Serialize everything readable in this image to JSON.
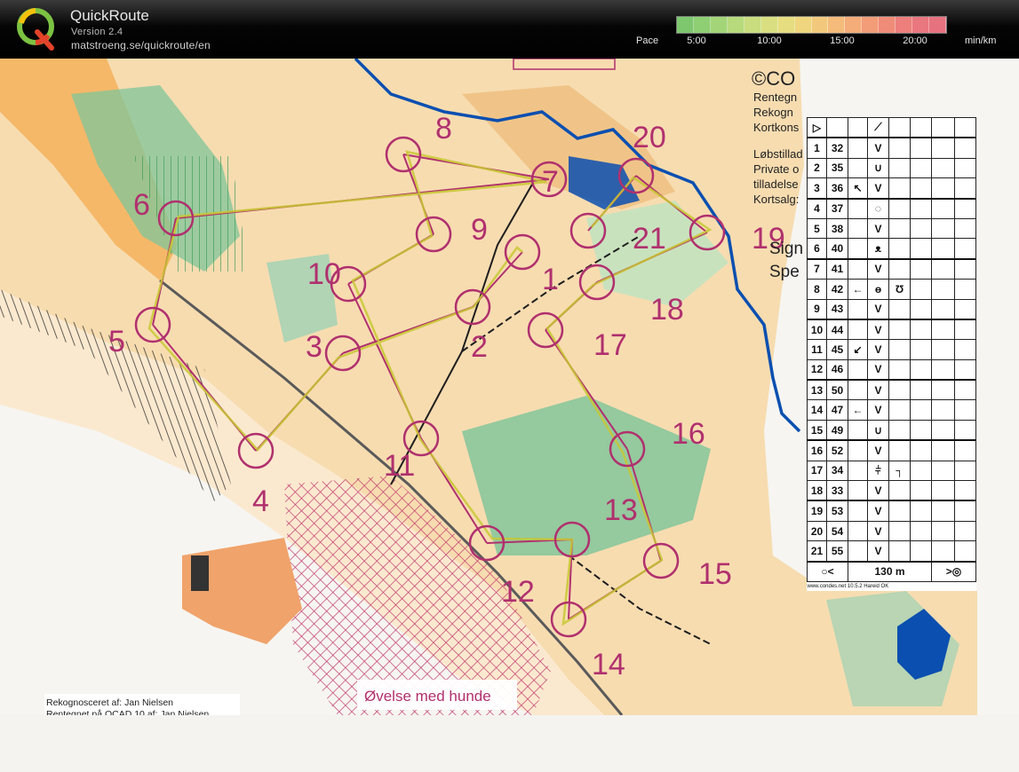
{
  "app": {
    "title": "QuickRoute",
    "version": "Version 2.4",
    "url": "matstroeng.se/quickroute/en",
    "logo_letter": "Q"
  },
  "pace_scale": {
    "label": "Pace",
    "ticks": [
      "5:00",
      "10:00",
      "15:00",
      "20:00"
    ],
    "unit": "min/km",
    "colors": [
      "#7ec76f",
      "#8fcf73",
      "#a3d578",
      "#b7da7c",
      "#c9dd7f",
      "#d9df80",
      "#e6dc80",
      "#eed57e",
      "#f2c97c",
      "#f4bb7a",
      "#f4ac78",
      "#f29c78",
      "#ef8c79",
      "#ec7f7c",
      "#e9777f",
      "#e7727f"
    ]
  },
  "map": {
    "background": "#f6e2c4",
    "course_color": "#b0306e",
    "route_color": "#c8c832",
    "water_color": "#0b4fb0",
    "copyright_text": "©CO",
    "info_lines": [
      "Rentegn",
      "Rekogn",
      "Kortkons",
      "Løbstillad",
      "Private o",
      "tilladelse",
      "Kortsalg:"
    ],
    "sign_lines": [
      "Sign",
      "Spe"
    ],
    "footer_lines": [
      "Rekognosceret af: Jan Nielsen",
      "Rentegnet på OCAD 10 af: Jan Nielsen"
    ],
    "exercise_label": "Øvelse med hunde",
    "controls": [
      {
        "num": "1",
        "label_num": "1"
      },
      {
        "num": "2",
        "label_num": "2"
      },
      {
        "num": "3",
        "label_num": "3"
      },
      {
        "num": "4",
        "label_num": "4"
      },
      {
        "num": "5",
        "label_num": "5"
      },
      {
        "num": "6",
        "label_num": "6"
      },
      {
        "num": "7",
        "label_num": "7"
      },
      {
        "num": "8",
        "label_num": "8"
      },
      {
        "num": "9",
        "label_num": "9"
      },
      {
        "num": "10",
        "label_num": "10"
      },
      {
        "num": "11",
        "label_num": "11"
      },
      {
        "num": "12",
        "label_num": "12"
      },
      {
        "num": "13",
        "label_num": "13"
      },
      {
        "num": "14",
        "label_num": "14"
      },
      {
        "num": "15",
        "label_num": "15"
      },
      {
        "num": "16",
        "label_num": "16"
      },
      {
        "num": "17",
        "label_num": "17"
      },
      {
        "num": "18",
        "label_num": "18"
      },
      {
        "num": "19",
        "label_num": "19"
      },
      {
        "num": "20",
        "label_num": "20"
      },
      {
        "num": "21",
        "label_num": "21"
      }
    ]
  },
  "description_sheet": {
    "rows": [
      {
        "n": "1",
        "code": "32",
        "dir": "",
        "feature": "V",
        "appearance": ""
      },
      {
        "n": "2",
        "code": "35",
        "dir": "",
        "feature": "∪",
        "appearance": ""
      },
      {
        "n": "3",
        "code": "36",
        "dir": "↖",
        "feature": "V",
        "appearance": ""
      },
      {
        "n": "4",
        "code": "37",
        "dir": "",
        "feature": "◌",
        "appearance": ""
      },
      {
        "n": "5",
        "code": "38",
        "dir": "",
        "feature": "V",
        "appearance": ""
      },
      {
        "n": "6",
        "code": "40",
        "dir": "",
        "feature": "ᴥ",
        "appearance": ""
      },
      {
        "n": "7",
        "code": "41",
        "dir": "",
        "feature": "V",
        "appearance": ""
      },
      {
        "n": "8",
        "code": "42",
        "dir": "←",
        "feature": "ɵ",
        "appearance": "Ʊ"
      },
      {
        "n": "9",
        "code": "43",
        "dir": "",
        "feature": "V",
        "appearance": ""
      },
      {
        "n": "10",
        "code": "44",
        "dir": "",
        "feature": "V",
        "appearance": ""
      },
      {
        "n": "11",
        "code": "45",
        "dir": "↙",
        "feature": "V",
        "appearance": ""
      },
      {
        "n": "12",
        "code": "46",
        "dir": "",
        "feature": "V",
        "appearance": ""
      },
      {
        "n": "13",
        "code": "50",
        "dir": "",
        "feature": "V",
        "appearance": ""
      },
      {
        "n": "14",
        "code": "47",
        "dir": "←",
        "feature": "V",
        "appearance": ""
      },
      {
        "n": "15",
        "code": "49",
        "dir": "",
        "feature": "∪",
        "appearance": ""
      },
      {
        "n": "16",
        "code": "52",
        "dir": "",
        "feature": "V",
        "appearance": ""
      },
      {
        "n": "17",
        "code": "34",
        "dir": "",
        "feature": "⫩",
        "appearance": "┐"
      },
      {
        "n": "18",
        "code": "33",
        "dir": "",
        "feature": "V",
        "appearance": ""
      },
      {
        "n": "19",
        "code": "53",
        "dir": "",
        "feature": "V",
        "appearance": ""
      },
      {
        "n": "20",
        "code": "54",
        "dir": "",
        "feature": "V",
        "appearance": ""
      },
      {
        "n": "21",
        "code": "55",
        "dir": "",
        "feature": "V",
        "appearance": ""
      }
    ],
    "header_start_symbol": "▷",
    "header_slash": "⟋",
    "finish_distance": "130 m",
    "finish_left_symbol": "○<",
    "finish_right_symbol": ">◎",
    "credit": "www.condes.net 10.5.2 Hareid OK"
  }
}
